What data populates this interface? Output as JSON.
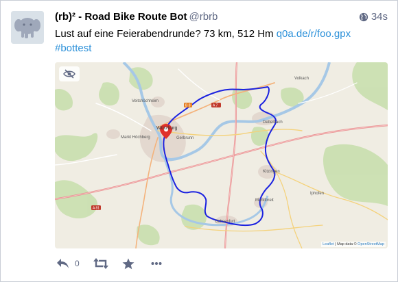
{
  "account": {
    "display_name": "(rb)² - Road Bike Route Bot",
    "handle": "@rbrb"
  },
  "status": {
    "relative_time": "34s",
    "text": "Lust auf eine Feierabendrunde? 73 km, 512 Hm ",
    "link_text": "q0a.de/r/foo.gpx",
    "hashtag": "#bottest"
  },
  "map": {
    "place_labels": {
      "wurzburg": "Würzburg",
      "veitshochheim": "Veitshöchheim",
      "markt_hochberg": "Markt Höchberg",
      "gerbrunn": "Gerbrunn",
      "dettelbach": "Dettelbach",
      "kitzingen": "Kitzingen",
      "marktbreit": "Marktbreit",
      "ochsenfurt": "Ochsenfurt",
      "iphofen": "Iphofen",
      "volkach": "Volkach",
      "a7": "A 7",
      "a81": "A 81",
      "b8": "B 8"
    },
    "attribution": {
      "leaflet": "Leaflet",
      "separator": " | Map data © ",
      "osm": "OpenStreetMap"
    },
    "route_color": "#1b22e0",
    "marker_color": "#e0312b"
  },
  "actions": {
    "reply_count": "0"
  },
  "colors": {
    "link": "#2b90d9",
    "muted": "#606984"
  }
}
